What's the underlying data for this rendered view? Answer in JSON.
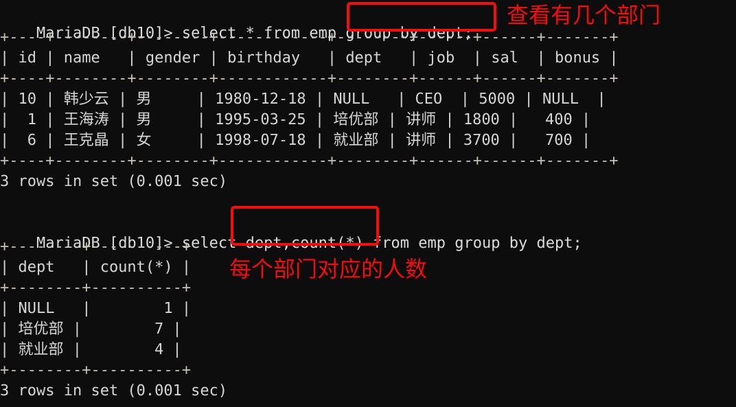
{
  "terminal": {
    "background": "#0d0d0d",
    "foreground": "#d6d6d6",
    "annotation_color": "#f50d0d",
    "prompt": "MariaDB [db10]> "
  },
  "block1": {
    "command_prefix": "MariaDB [db10]> select * from emp ",
    "command_highlight": "group by dept;",
    "annotation": "查看有几个部门",
    "table": {
      "rule": "+----+--------+--------+------------+--------+------+------+-------+",
      "header": "| id | name   | gender | birthday   | dept   | job  | sal  | bonus |",
      "rows": [
        "| 10 | 韩少云 | 男     | 1980-12-18 | NULL   | CEO  | 5000 | NULL  |",
        "|  1 | 王海涛 | 男     | 1995-03-25 | 培优部 | 讲师 | 1800 |   400 |",
        "|  6 | 王克晶 | 女     | 1998-07-18 | 就业部 | 讲师 | 3700 |   700 |"
      ],
      "columns": [
        "id",
        "name",
        "gender",
        "birthday",
        "dept",
        "job",
        "sal",
        "bonus"
      ],
      "data": [
        {
          "id": "10",
          "name": "韩少云",
          "gender": "男",
          "birthday": "1980-12-18",
          "dept": "NULL",
          "job": "CEO",
          "sal": "5000",
          "bonus": "NULL"
        },
        {
          "id": "1",
          "name": "王海涛",
          "gender": "男",
          "birthday": "1995-03-25",
          "dept": "培优部",
          "job": "讲师",
          "sal": "1800",
          "bonus": "400"
        },
        {
          "id": "6",
          "name": "王克晶",
          "gender": "女",
          "birthday": "1998-07-18",
          "dept": "就业部",
          "job": "讲师",
          "sal": "3700",
          "bonus": "700"
        }
      ]
    },
    "status": "3 rows in set (0.001 sec)"
  },
  "block2": {
    "command_prefix": "MariaDB [db10]> select ",
    "command_highlight": "dept,count(*)",
    "command_suffix": " from emp group by dept;",
    "annotation": "每个部门对应的人数",
    "table": {
      "rule": "+--------+----------+",
      "header": "| dept   | count(*) |",
      "rows": [
        "| NULL   |        1 |",
        "| 培优部 |        7 |",
        "| 就业部 |        4 |"
      ],
      "columns": [
        "dept",
        "count(*)"
      ],
      "data": [
        {
          "dept": "NULL",
          "count": "1"
        },
        {
          "dept": "培优部",
          "count": "7"
        },
        {
          "dept": "就业部",
          "count": "4"
        }
      ]
    },
    "status": "3 rows in set (0.001 sec)"
  }
}
